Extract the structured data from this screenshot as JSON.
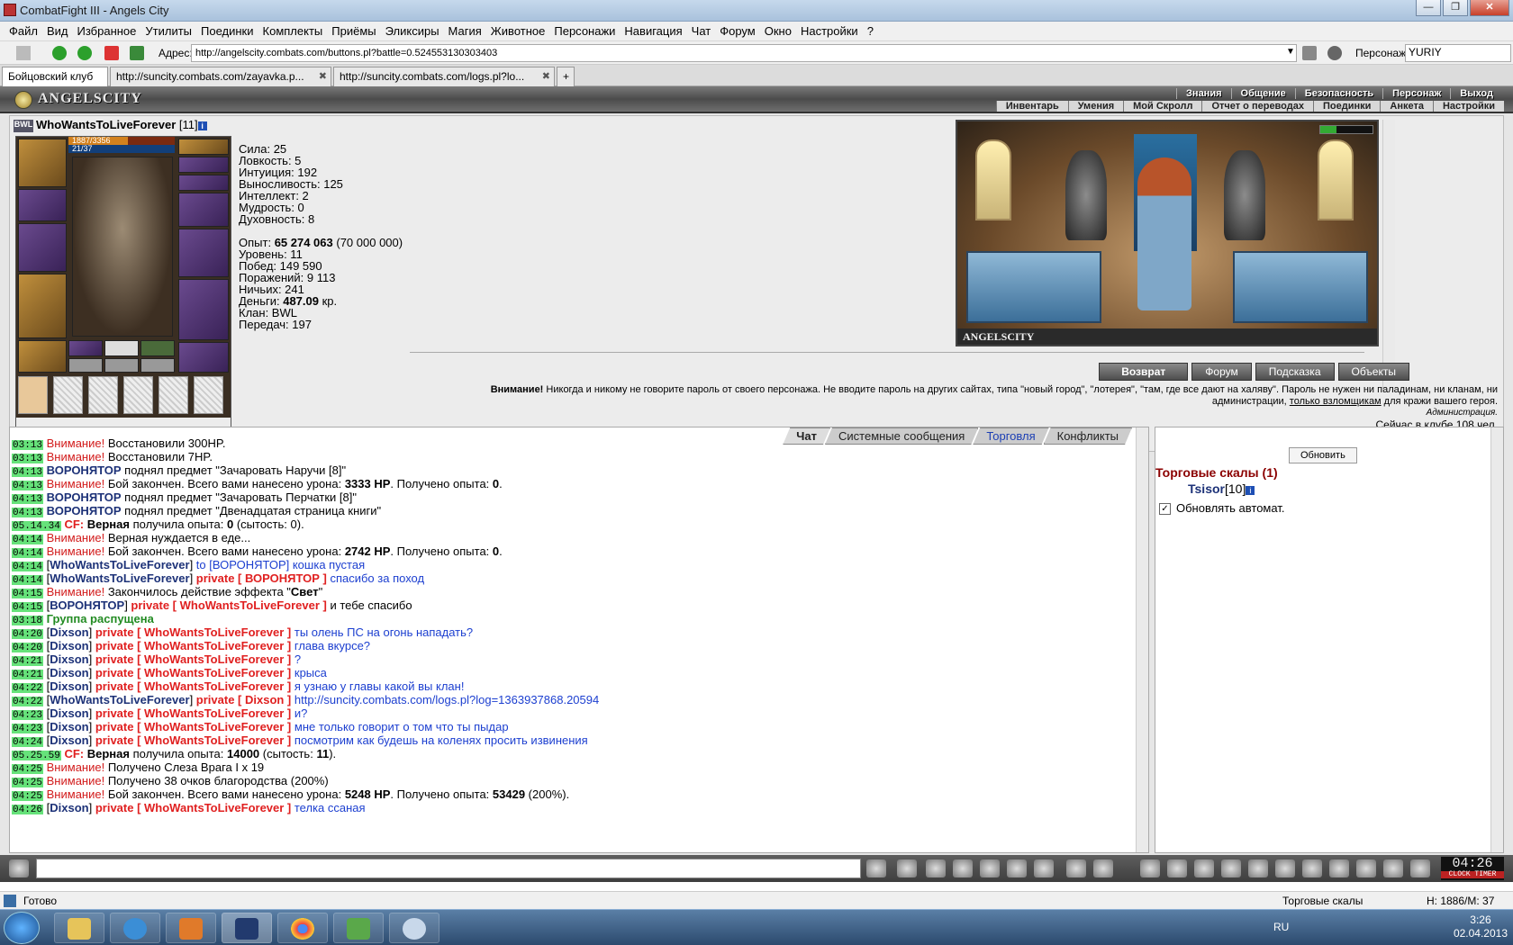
{
  "window": {
    "title": "CombatFight III - Angels City",
    "buttons": [
      "—",
      "❐",
      "✕"
    ]
  },
  "menu": [
    "Файл",
    "Вид",
    "Избранное",
    "Утилиты",
    "Поединки",
    "Комплекты",
    "Приёмы",
    "Эликсиры",
    "Магия",
    "Животное",
    "Персонажи",
    "Навигация",
    "Чат",
    "Форум",
    "Окно",
    "Настройки",
    "?"
  ],
  "address": {
    "label": "Адрес:",
    "url": "http://angelscity.combats.com/buttons.pl?battle=0.524553130303403",
    "persona_label": "Персонаж:",
    "persona": "YURIY"
  },
  "tabs": [
    {
      "label": "Бойцовский клуб"
    },
    {
      "label": "http://suncity.combats.com/zayavka.p..."
    },
    {
      "label": "http://suncity.combats.com/logs.pl?lo..."
    }
  ],
  "game": {
    "logo": "ANGELSCITY",
    "nav_top": [
      "Знания",
      "Общение",
      "Безопасность",
      "Персонаж",
      "Выход"
    ],
    "nav_sub": [
      "Инвентарь",
      "Умения",
      "Мой Скролл",
      "Отчет о переводах",
      "Поединки",
      "Анкета",
      "Настройки"
    ],
    "character": {
      "clan_tag": "BWL",
      "name": "WhoWantsToLiveForever",
      "level": "[11]",
      "info_icon": "i",
      "hp": "1887/3356",
      "hp_fraction": 0.562,
      "mp": "21/37"
    },
    "stats": [
      "Сила: 25",
      "Ловкость: 5",
      "Интуиция: 192",
      "Выносливость: 125",
      "Интеллект: 2",
      "Мудрость: 0",
      "Духовность: 8"
    ],
    "stats2": {
      "exp_label": "Опыт: ",
      "exp": "65 274 063",
      "exp_next": " (70 000 000)",
      "level": "Уровень: 11",
      "wins": "Побед: 149 590",
      "losses": "Поражений: 9 113",
      "draws": "Ничьих: 241",
      "money_label": "Деньги: ",
      "money": "487.09",
      "money_unit": " кр.",
      "clan": "Клан: BWL",
      "transfers": "Передач: 197"
    },
    "scene_caption": "ANGELSCITY",
    "buttons": [
      "Возврат",
      "Форум",
      "Подсказка",
      "Объекты"
    ],
    "warning": {
      "bold": "Внимание!",
      "text": " Никогда и никому не говорите пароль от своего персонажа. Не вводите пароль на других сайтах, типа \"новый город\", \"лотерея\", \"там, где все дают на халяву\". Пароль не нужен ни паладинам, ни кланам, ни администрации, ",
      "link": "только взломщикам",
      "tail": " для кражи вашего героя."
    },
    "admin": "Администрация.",
    "online": "Сейчас в клубе 108 чел."
  },
  "chat": {
    "tabs": [
      "Чат",
      "Системные сообщения",
      "Торговля",
      "Конфликты"
    ],
    "lines": [
      {
        "t": "03:13",
        "att": "Внимание!",
        "rest": " Восстановили 300HP."
      },
      {
        "t": "03:13",
        "att": "Внимание!",
        "rest": " Восстановили 7HP."
      },
      {
        "t": "04:13",
        "nick": "ВОРОНЯТОР",
        "rest": " поднял предмет \"Зачаровать Наручи [8]\""
      },
      {
        "t": "04:13",
        "att": "Внимание!",
        "rest": " Бой закончен. Всего вами нанесено урона: ",
        "b1": "3333 HP",
        "rest2": ". Получено опыта: ",
        "b2": "0",
        "rest3": "."
      },
      {
        "t": "04:13",
        "nick": "ВОРОНЯТОР",
        "rest": " поднял предмет \"Зачаровать Перчатки [8]\""
      },
      {
        "t": "04:13",
        "nick": "ВОРОНЯТОР",
        "rest": " поднял предмет \"Двенадцатая страница книги\""
      },
      {
        "t": "05.14.34",
        "cf": "CF:",
        "rest": " ",
        "b1": "Верная",
        "rest2": " получила опыта: ",
        "b2": "0",
        "rest3": " (сытость: 0)."
      },
      {
        "t": "04:14",
        "att": "Внимание!",
        "rest": " Верная нуждается в еде..."
      },
      {
        "t": "04:14",
        "att": "Внимание!",
        "rest": " Бой закончен. Всего вами нанесено урона: ",
        "b1": "2742 HP",
        "rest2": ". Получено опыта: ",
        "b2": "0",
        "rest3": "."
      },
      {
        "t": "04:14",
        "from": "WhoWantsToLiveForever",
        "msg": " to [ВОРОНЯТОР] кошка пустая"
      },
      {
        "t": "04:14",
        "from": "WhoWantsToLiveForever",
        "priv": "private [ ВОРОНЯТОР ]",
        "msg": " спасибо за поход"
      },
      {
        "t": "04:15",
        "att": "Внимание!",
        "rest": " Закончилось действие эффекта \"",
        "b1": "Свет",
        "rest2": "\""
      },
      {
        "t": "04:15",
        "from": "ВОРОНЯТОР",
        "priv": "private [ WhoWantsToLiveForever ]",
        "plain": " и тебе спасибо"
      },
      {
        "t": "03:18",
        "grn": "Группа распущена"
      },
      {
        "t": "04:20",
        "from": "Dixson",
        "priv": "private [ WhoWantsToLiveForever ]",
        "msg": " ты олень ПС на огонь нападать?"
      },
      {
        "t": "04:20",
        "from": "Dixson",
        "priv": "private [ WhoWantsToLiveForever ]",
        "msg": " глава вкурсе?"
      },
      {
        "t": "04:21",
        "from": "Dixson",
        "priv": "private [ WhoWantsToLiveForever ]",
        "msg": " ?"
      },
      {
        "t": "04:21",
        "from": "Dixson",
        "priv": "private [ WhoWantsToLiveForever ]",
        "msg": " крыса"
      },
      {
        "t": "04:22",
        "from": "Dixson",
        "priv": "private [ WhoWantsToLiveForever ]",
        "msg": " я узнаю у главы какой вы клан!"
      },
      {
        "t": "04:22",
        "from": "WhoWantsToLiveForever",
        "priv": "private [ Dixson ]",
        "msg": " http://suncity.combats.com/logs.pl?log=1363937868.20594"
      },
      {
        "t": "04:23",
        "from": "Dixson",
        "priv": "private [ WhoWantsToLiveForever ]",
        "msg": " и?"
      },
      {
        "t": "04:23",
        "from": "Dixson",
        "priv": "private [ WhoWantsToLiveForever ]",
        "msg": " мне только говорит о том что ты пыдар"
      },
      {
        "t": "04:24",
        "from": "Dixson",
        "priv": "private [ WhoWantsToLiveForever ]",
        "msg": " посмотрим как будешь на коленях просить извинения"
      },
      {
        "t": "05.25.59",
        "cf": "CF:",
        "rest": " ",
        "b1": "Верная",
        "rest2": " получила опыта: ",
        "b2": "14000",
        "rest3": " (сытость: ",
        "b3": "11",
        "rest4": ")."
      },
      {
        "t": "04:25",
        "att": "Внимание!",
        "rest": " Получено Слеза Врага I x 19"
      },
      {
        "t": "04:25",
        "att": "Внимание!",
        "rest": " Получено 38 очков благородства (200%)"
      },
      {
        "t": "04:25",
        "att": "Внимание!",
        "rest": " Бой закончен. Всего вами нанесено урона: ",
        "b1": "5248 HP",
        "rest2": ". Получено опыта: ",
        "b2": "53429",
        "rest3": " (200%)."
      },
      {
        "t": "04:26",
        "from": "Dixson",
        "priv": "private [ WhoWantsToLiveForever ]",
        "msg": " телка ссаная"
      }
    ]
  },
  "side": {
    "refresh": "Обновить",
    "location": "Торговые скалы (1)",
    "user": "Tsisor",
    "user_level": "[10]",
    "auto_label": "Обновлять автомат.",
    "auto_checked": "✓"
  },
  "clock": {
    "time": "04:26",
    "sub": "CLOCK TIMER"
  },
  "status": {
    "left": "Готово",
    "mid": "Торговые скалы",
    "right": "H: 1886/M: 37"
  },
  "taskbar": {
    "lang": "RU",
    "time": "3:26",
    "date": "02.04.2013"
  }
}
